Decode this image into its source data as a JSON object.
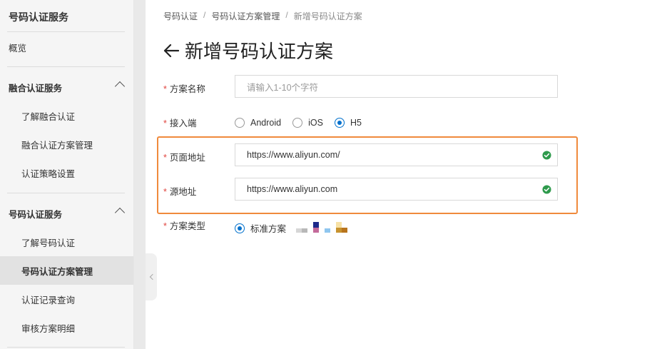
{
  "sidebar": {
    "title": "号码认证服务",
    "overview": "概览",
    "groups": [
      {
        "label": "融合认证服务",
        "items": [
          "了解融合认证",
          "融合认证方案管理",
          "认证策略设置"
        ]
      },
      {
        "label": "号码认证服务",
        "items": [
          "了解号码认证",
          "号码认证方案管理",
          "认证记录查询",
          "审核方案明细"
        ]
      }
    ],
    "active_item": "号码认证方案管理"
  },
  "breadcrumb": [
    "号码认证",
    "号码认证方案管理",
    "新增号码认证方案"
  ],
  "breadcrumb_separator": "/",
  "page": {
    "title": "新增号码认证方案"
  },
  "form": {
    "required_mark": "*",
    "scheme_name": {
      "label": "方案名称",
      "placeholder": "请输入1-10个字符",
      "value": ""
    },
    "access_port": {
      "label": "接入端",
      "options": [
        "Android",
        "iOS",
        "H5"
      ],
      "selected": "H5"
    },
    "page_url": {
      "label": "页面地址",
      "value": "https://www.aliyun.com/"
    },
    "source_url": {
      "label": "源地址",
      "value": "https://www.aliyun.com"
    },
    "scheme_type": {
      "label": "方案类型",
      "options": [
        "标准方案"
      ],
      "selected": "标准方案"
    }
  },
  "colors": {
    "accent": "#0070cc",
    "required": "#e0453f",
    "highlight": "#f08a3c",
    "valid": "#2e9a4c"
  },
  "icons": {
    "back": "arrow-left-icon",
    "valid": "check-circle-icon",
    "collapse": "chevron-left-icon"
  }
}
